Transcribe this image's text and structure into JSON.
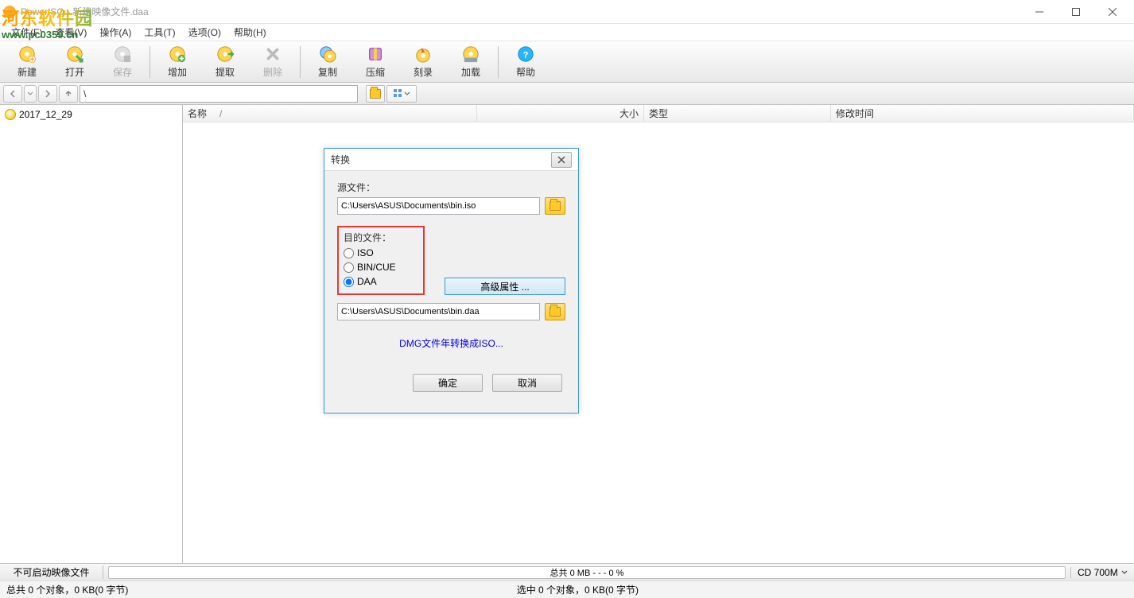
{
  "window": {
    "title": "PowerISO - 新建映像文件.daa"
  },
  "menu": {
    "file": "文件(F)",
    "view": "查看(V)",
    "action": "操作(A)",
    "tools": "工具(T)",
    "options": "选项(O)",
    "help": "帮助(H)"
  },
  "toolbar": {
    "new": "新建",
    "open": "打开",
    "save": "保存",
    "add": "增加",
    "extract": "提取",
    "delete": "删除",
    "copy": "复制",
    "compress": "压缩",
    "burn": "刻录",
    "mount": "加载",
    "help": "帮助"
  },
  "nav": {
    "path": "\\"
  },
  "tree": {
    "root": "2017_12_29"
  },
  "columns": {
    "name": "名称",
    "sort_marker": "/",
    "size": "大小",
    "type": "类型",
    "modified": "修改时间"
  },
  "dialog": {
    "title": "转换",
    "source_label": "源文件：",
    "source_path": "C:\\Users\\ASUS\\Documents\\bin.iso",
    "dest_label": "目的文件：",
    "opt_iso": "ISO",
    "opt_bincue": "BIN/CUE",
    "opt_daa": "DAA",
    "advanced": "高级属性 ...",
    "dest_path": "C:\\Users\\ASUS\\Documents\\bin.daa",
    "dmg_link": "DMG文件年转换成ISO...",
    "ok": "确定",
    "cancel": "取消"
  },
  "status": {
    "boot": "不可启动映像文件",
    "progress": "总共  0 MB   - - -  0 %",
    "disc": "CD 700M",
    "left": "总共 0 个对象，0 KB(0 字节)",
    "right": "选中 0 个对象，0 KB(0 字节)"
  },
  "watermark": {
    "title": "河东软件园",
    "url": "www.pc0359.cn"
  }
}
